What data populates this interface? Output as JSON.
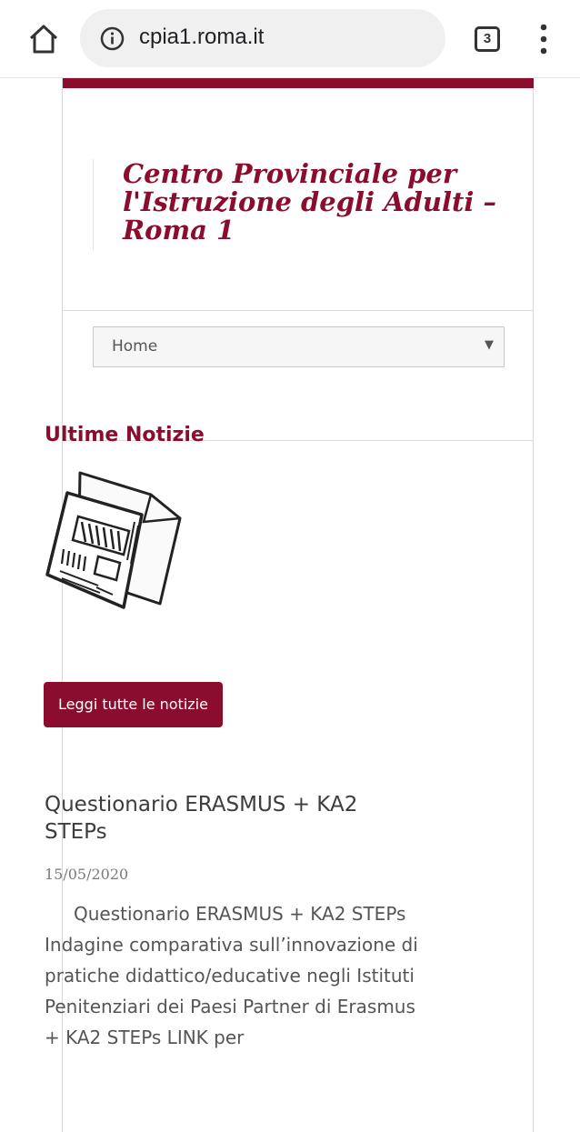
{
  "browser": {
    "url": "cpia1.roma.it",
    "tab_count": "3",
    "icons": [
      "home-icon",
      "info-icon",
      "tab-switcher-icon",
      "overflow-menu-icon"
    ]
  },
  "site": {
    "title": "Centro Provinciale per l'Istruzione degli Adulti – Roma 1",
    "accent_color": "#8b0d2e"
  },
  "nav": {
    "selected": "Home"
  },
  "news": {
    "heading": "Ultime Notizie",
    "read_all_label": "Leggi tutte le notizie",
    "article": {
      "title": "Questionario ERASMUS + KA2 STEPs",
      "date": "15/05/2020",
      "excerpt": "Questionario ERASMUS + KA2 STEPs Indagine comparativa sull’innovazione di pratiche didattico/educative negli Istituti Penitenziari dei Paesi Partner di Erasmus + KA2 STEPs LINK per"
    }
  }
}
